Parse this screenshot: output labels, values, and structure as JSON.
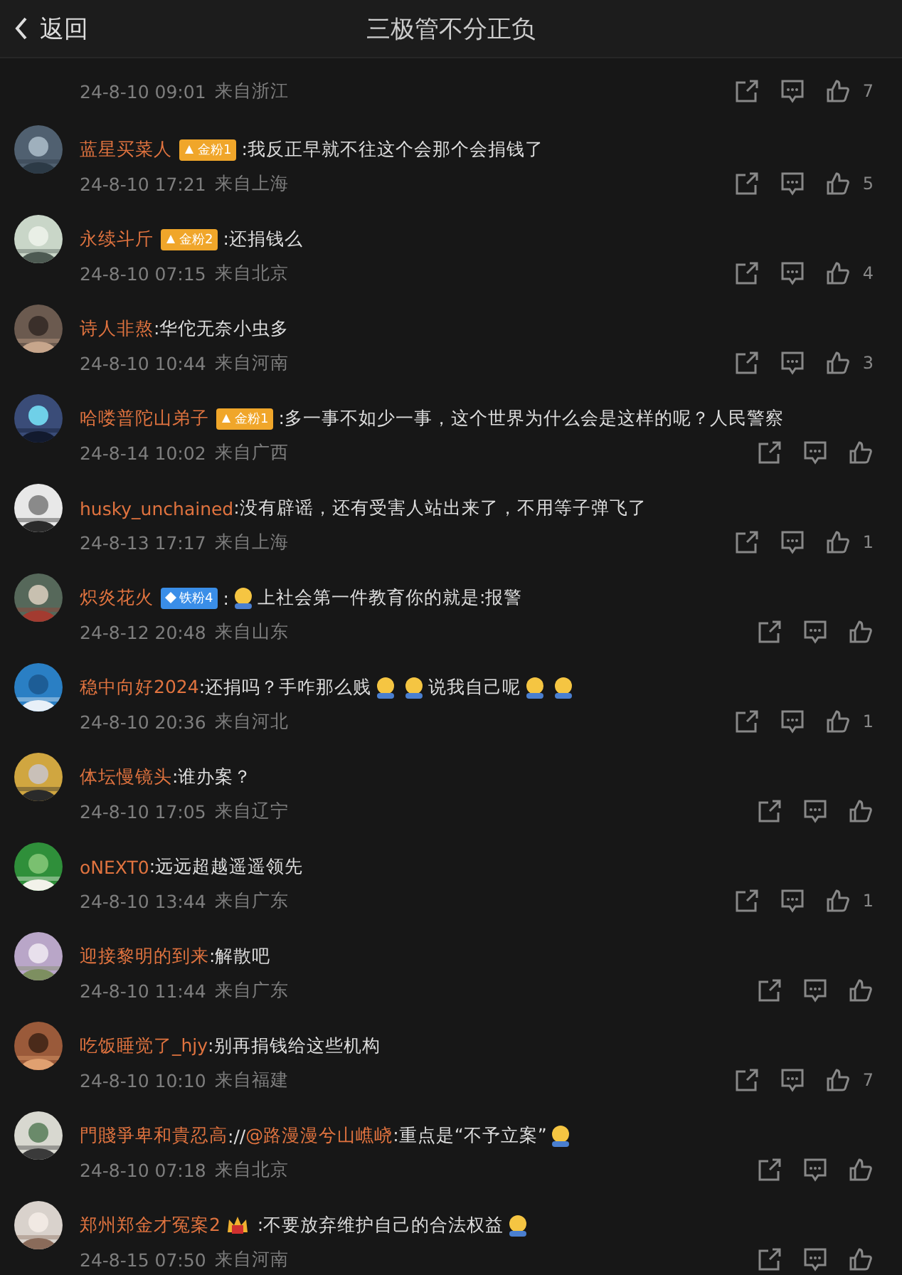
{
  "header": {
    "back": "返回",
    "title": "三极管不分正负"
  },
  "comments": [
    {
      "partial": true,
      "date": "24-8-10 09:01",
      "location": "来自浙江",
      "likes": "7"
    },
    {
      "name": "蓝星买菜人",
      "badge": {
        "kind": "gold",
        "text": "金粉1"
      },
      "parts": [
        {
          "kind": "text",
          "text": ":我反正早就不往这个会那个会捐钱了"
        }
      ],
      "date": "24-8-10 17:21",
      "location": "来自上海",
      "likes": "5"
    },
    {
      "name": "永续斗斤",
      "badge": {
        "kind": "gold",
        "text": "金粉2"
      },
      "parts": [
        {
          "kind": "text",
          "text": ":还捐钱么"
        }
      ],
      "date": "24-8-10 07:15",
      "location": "来自北京",
      "likes": "4"
    },
    {
      "name": "诗人非熬",
      "parts": [
        {
          "kind": "text",
          "text": ":华佗无奈小虫多"
        }
      ],
      "date": "24-8-10 10:44",
      "location": "来自河南",
      "likes": "3"
    },
    {
      "name": "哈喽普陀山弟子",
      "badge": {
        "kind": "gold",
        "text": "金粉1"
      },
      "parts": [
        {
          "kind": "text",
          "text": ":多一事不如少一事，这个世界为什么会是这样的呢？人民警察"
        }
      ],
      "date": "24-8-14 10:02",
      "location": "来自广西"
    },
    {
      "name": "husky_unchained",
      "parts": [
        {
          "kind": "text",
          "text": ":没有辟谣，还有受害人站出来了，不用等子弹飞了"
        }
      ],
      "date": "24-8-13 17:17",
      "location": "来自上海",
      "likes": "1"
    },
    {
      "name": "炽炎花火",
      "badge": {
        "kind": "diamond",
        "text": "铁粉4"
      },
      "parts": [
        {
          "kind": "text",
          "text": ":"
        },
        {
          "kind": "emoji"
        },
        {
          "kind": "text",
          "text": "上社会第一件教育你的就是:报警"
        }
      ],
      "date": "24-8-12 20:48",
      "location": "来自山东"
    },
    {
      "name": "稳中向好2024",
      "parts": [
        {
          "kind": "text",
          "text": ":还捐吗？手咋那么贱"
        },
        {
          "kind": "emoji"
        },
        {
          "kind": "emoji"
        },
        {
          "kind": "text",
          "text": "说我自己呢"
        },
        {
          "kind": "emoji"
        },
        {
          "kind": "emoji"
        }
      ],
      "date": "24-8-10 20:36",
      "location": "来自河北",
      "likes": "1"
    },
    {
      "name": "体坛慢镜头",
      "parts": [
        {
          "kind": "text",
          "text": ":谁办案？"
        }
      ],
      "date": "24-8-10 17:05",
      "location": "来自辽宁"
    },
    {
      "name": "oNEXT0",
      "parts": [
        {
          "kind": "text",
          "text": ":远远超越遥遥领先"
        }
      ],
      "date": "24-8-10 13:44",
      "location": "来自广东",
      "likes": "1"
    },
    {
      "name": "迎接黎明的到来",
      "parts": [
        {
          "kind": "text",
          "text": ":解散吧"
        }
      ],
      "date": "24-8-10 11:44",
      "location": "来自广东"
    },
    {
      "name": "吃饭睡觉了_hjy",
      "parts": [
        {
          "kind": "text",
          "text": ":别再捐钱给这些机构"
        }
      ],
      "date": "24-8-10 10:10",
      "location": "来自福建",
      "likes": "7"
    },
    {
      "name": "門賤爭卑和貴忍高",
      "parts": [
        {
          "kind": "text",
          "text": "://"
        },
        {
          "kind": "mention",
          "text": "@路漫漫兮山嶕峣"
        },
        {
          "kind": "text",
          "text": ":重点是“不予立案”"
        },
        {
          "kind": "emoji"
        }
      ],
      "date": "24-8-10 07:18",
      "location": "来自北京"
    },
    {
      "name": "郑州郑金才冤案2",
      "badge": {
        "kind": "crown"
      },
      "parts": [
        {
          "kind": "text",
          "text": " :不要放弃维护自己的合法权益"
        },
        {
          "kind": "emoji"
        }
      ],
      "date": "24-8-15 07:50",
      "location": "来自河南"
    }
  ]
}
